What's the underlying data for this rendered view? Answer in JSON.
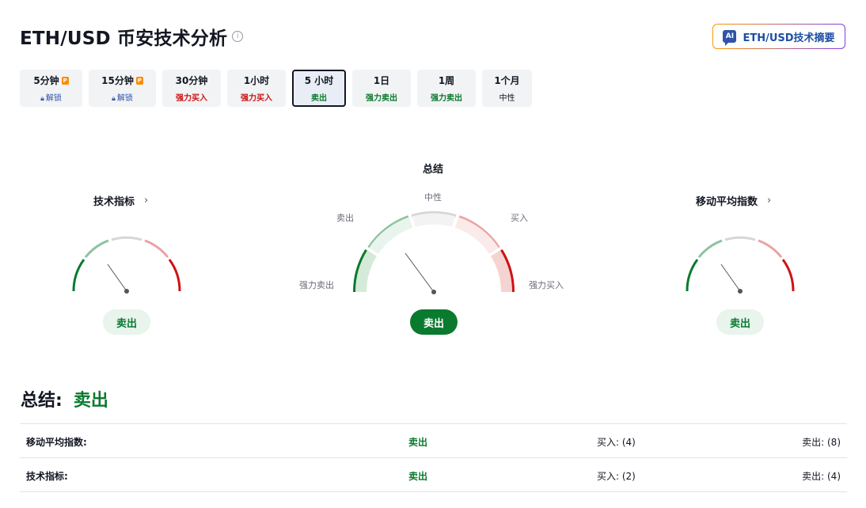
{
  "header": {
    "title": "ETH/USD 币安技术分析",
    "info_icon": "i",
    "ai_button_label": "ETH/USD技术摘要",
    "ai_icon_text": "AI"
  },
  "tabs": [
    {
      "label": "5分钟",
      "sub": "解锁",
      "premium": true
    },
    {
      "label": "15分钟",
      "sub": "解锁",
      "premium": true
    },
    {
      "label": "30分钟",
      "sub": "强力买入"
    },
    {
      "label": "1小时",
      "sub": "强力买入"
    },
    {
      "label": "5 小时",
      "sub": "卖出",
      "active": true
    },
    {
      "label": "1日",
      "sub": "强力卖出"
    },
    {
      "label": "1周",
      "sub": "强力卖出"
    },
    {
      "label": "1个月",
      "sub": "中性"
    }
  ],
  "gauges": {
    "oscillators": {
      "title": "技术指标",
      "result": "卖出"
    },
    "summary": {
      "title": "总结",
      "result": "卖出",
      "labels": {
        "neutral": "中性",
        "sell": "卖出",
        "buy": "买入",
        "strong_sell": "强力卖出",
        "strong_buy": "强力买入"
      }
    },
    "moving_averages": {
      "title": "移动平均指数",
      "result": "卖出"
    }
  },
  "summary": {
    "label": "总结:",
    "value": "卖出"
  },
  "table": [
    {
      "name": "移动平均指数:",
      "signal": "卖出",
      "buy": "买入: (4)",
      "sell": "卖出: (8)"
    },
    {
      "name": "技术指标:",
      "signal": "卖出",
      "buy": "买入: (2)",
      "sell": "卖出: (4)"
    }
  ],
  "colors": {
    "green": "#0a7a2f",
    "red": "#cc1313",
    "blue": "#2f54a8"
  }
}
